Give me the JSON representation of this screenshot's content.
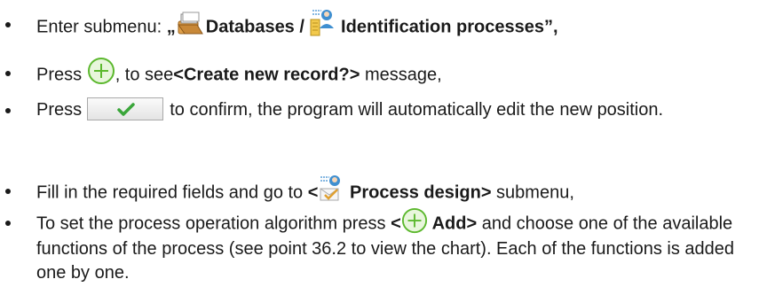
{
  "steps": [
    {
      "prefix": "Enter submenu: ",
      "open_quote": "„",
      "databases_label": "Databases /",
      "identification_label": "Identification processes",
      "close_quote": "”,",
      "databases_icon": "database-folder-icon",
      "identification_icon": "identification-process-icon"
    },
    {
      "prefix": "Press ",
      "add_icon": "add-circle-icon",
      "middle": ", to see",
      "message": "<Create new record?>",
      "suffix": " message,"
    },
    {
      "prefix": "Press ",
      "confirm_icon": "checkmark-button-icon",
      "suffix": " to confirm, the program will automatically edit the new position."
    },
    {
      "prefix": "Fill in the required fields and go to ",
      "open": "<",
      "design_icon": "process-design-icon",
      "label": " Process design>",
      "suffix": " submenu,"
    },
    {
      "prefix": "To set the process operation algorithm press ",
      "open": "<",
      "add_icon": "add-circle-icon",
      "label": " Add>",
      "suffix": " and choose one of the available functions of the process (see point 36.2 to view the chart). Each of the functions is added one by one."
    }
  ],
  "colors": {
    "text": "#1a1a1a",
    "add_green": "#5cb82e",
    "check_green": "#3aa63a",
    "folder": "#e0a04a",
    "person_blue": "#3f8fd0"
  }
}
